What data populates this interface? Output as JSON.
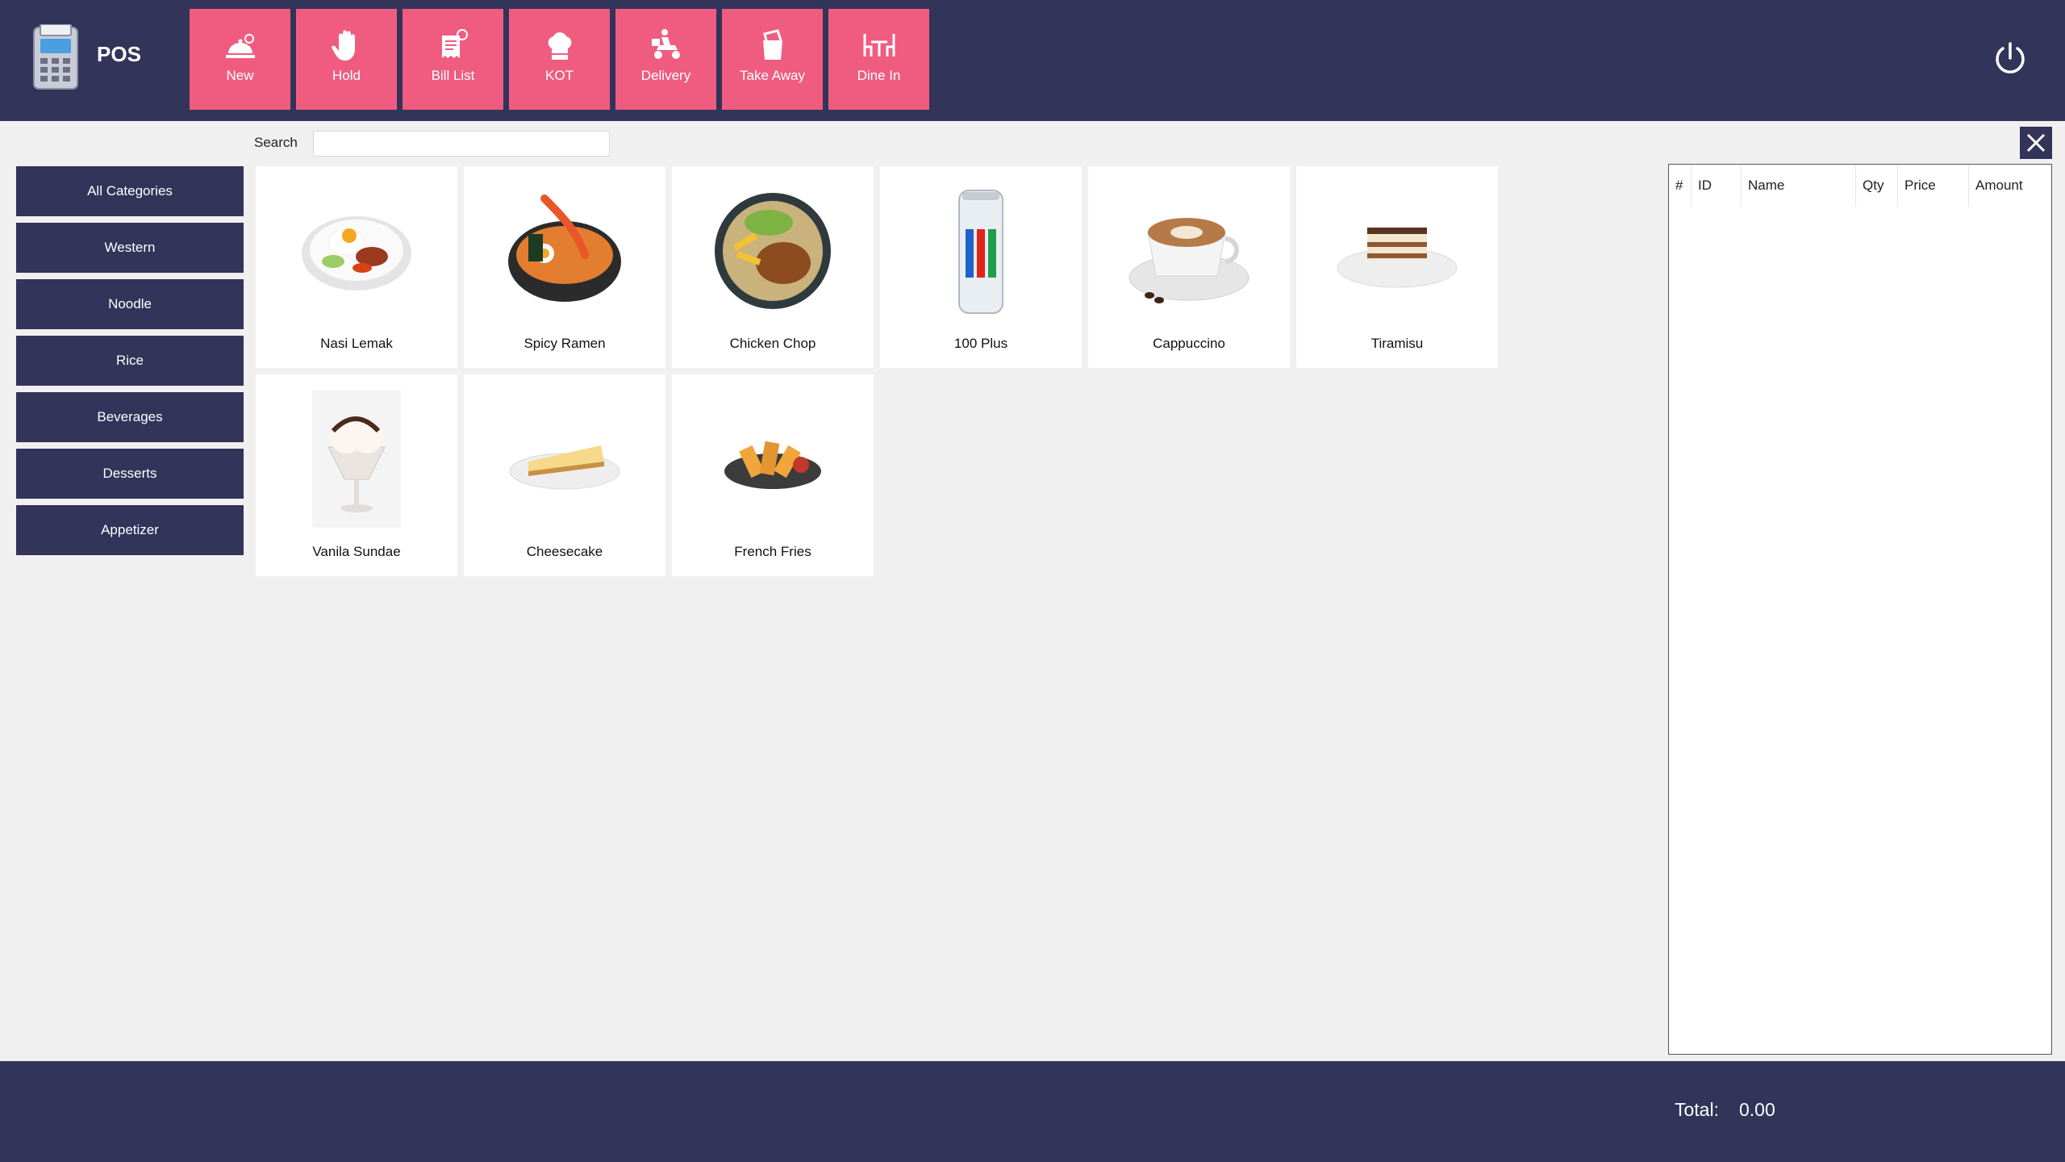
{
  "app": {
    "title": "POS"
  },
  "toolbar": [
    {
      "label": "New",
      "icon": "new-order-icon"
    },
    {
      "label": "Hold",
      "icon": "hand-icon"
    },
    {
      "label": "Bill List",
      "icon": "bill-list-icon"
    },
    {
      "label": "KOT",
      "icon": "chef-hat-icon"
    },
    {
      "label": "Delivery",
      "icon": "delivery-scooter-icon"
    },
    {
      "label": "Take Away",
      "icon": "take-away-bag-icon"
    },
    {
      "label": "Dine In",
      "icon": "dine-in-table-icon"
    }
  ],
  "search": {
    "label": "Search",
    "value": "",
    "placeholder": ""
  },
  "categories": [
    "All Categories",
    "Western",
    "Noodle",
    "Rice",
    "Beverages",
    "Desserts",
    "Appetizer"
  ],
  "products": [
    {
      "name": "Nasi Lemak",
      "image": "nasi-lemak-image"
    },
    {
      "name": "Spicy Ramen",
      "image": "spicy-ramen-image"
    },
    {
      "name": "Chicken Chop",
      "image": "chicken-chop-image"
    },
    {
      "name": "100 Plus",
      "image": "100-plus-can-image"
    },
    {
      "name": "Cappuccino",
      "image": "cappuccino-image"
    },
    {
      "name": "Tiramisu",
      "image": "tiramisu-image"
    },
    {
      "name": "Vanila Sundae",
      "image": "vanila-sundae-image"
    },
    {
      "name": "Cheesecake",
      "image": "cheesecake-image"
    },
    {
      "name": "French Fries",
      "image": "french-fries-image"
    }
  ],
  "order": {
    "columns": [
      "#",
      "ID",
      "Name",
      "Qty",
      "Price",
      "Amount"
    ],
    "rows": []
  },
  "footer": {
    "total_label": "Total:",
    "total_value": "0.00"
  },
  "colors": {
    "navy": "#32345a",
    "accent": "#f05c80",
    "background": "#f0f0f0"
  }
}
